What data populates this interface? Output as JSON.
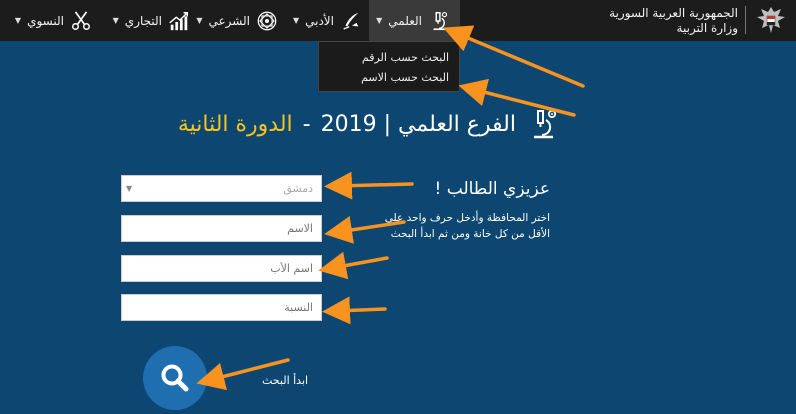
{
  "header": {
    "brand_line1": "الجمهورية العربية السورية",
    "brand_line2": "وزارة التربية"
  },
  "nav": {
    "items": [
      {
        "label": "العلمي",
        "icon": "microscope-icon"
      },
      {
        "label": "الأدبي",
        "icon": "quill-pen-icon"
      },
      {
        "label": "الشرعي",
        "icon": "islamic-pattern-icon"
      },
      {
        "label": "التجاري",
        "icon": "growth-chart-icon"
      },
      {
        "label": "النسوي",
        "icon": "scissors-icon"
      }
    ],
    "dropdown": [
      "البحث حسب الرقم",
      "البحث حسب الاسم"
    ]
  },
  "heading": {
    "main": "الفرع العلمي | 2019",
    "separator": "-",
    "sub": "الدورة الثانية"
  },
  "form": {
    "greeting": "عزيزي الطالب !",
    "instructions": "اختر المحافظة وأدخل حرف واحد على الأقل من كل خانة ومن ثم ابدأ البحث",
    "governorate_selected": "دمشق",
    "name_placeholder": "الاسم",
    "father_placeholder": "اسم الأب",
    "surname_placeholder": "النسبة",
    "search_label": "ابدأ البحث"
  },
  "colors": {
    "background": "#0d4670",
    "topbar": "#1c1c1c",
    "accent_yellow": "#f5c51f",
    "button_blue": "#1f6fb0",
    "arrow_orange": "#f7931e"
  }
}
